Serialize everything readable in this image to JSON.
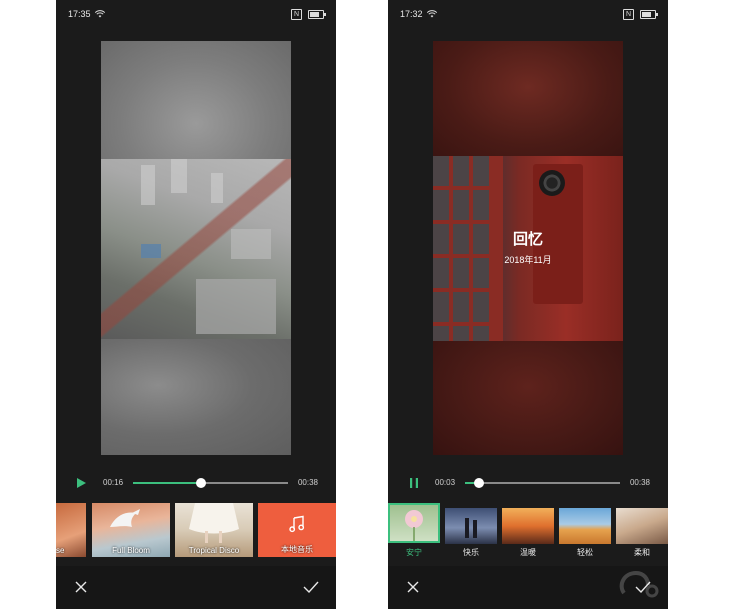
{
  "screens": [
    {
      "status": {
        "time": "17:35"
      },
      "player": {
        "current": "00:16",
        "total": "00:38",
        "progress": 0.44,
        "state": "paused"
      },
      "music_tiles": [
        {
          "label": "se"
        },
        {
          "label": "Full Bloom"
        },
        {
          "label": "Tropical Disco"
        },
        {
          "label": "本地音乐",
          "icon": "music-note-icon"
        }
      ]
    },
    {
      "status": {
        "time": "17:32"
      },
      "overlay": {
        "title": "回忆",
        "date": "2018年11月"
      },
      "player": {
        "current": "00:03",
        "total": "00:38",
        "progress": 0.09,
        "state": "playing"
      },
      "style_tiles": [
        {
          "label": "安宁",
          "selected": true
        },
        {
          "label": "快乐"
        },
        {
          "label": "温暖"
        },
        {
          "label": "轻松"
        },
        {
          "label": "柔和"
        }
      ]
    }
  ],
  "colors": {
    "accent": "#3cbf7e",
    "background": "#1b1b1b",
    "local_music_tile": "#ee5e3e"
  }
}
